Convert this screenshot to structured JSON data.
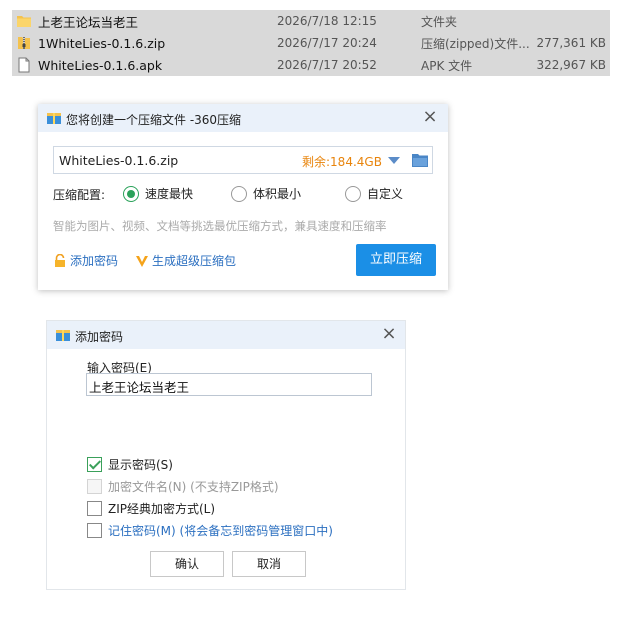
{
  "file_list": {
    "rows": [
      {
        "name": "上老王论坛当老王",
        "date": "2026/7/18 12:15",
        "type": "文件夹",
        "size": "",
        "icon": "folder-icon",
        "selected": true
      },
      {
        "name": "1WhiteLies-0.1.6.zip",
        "date": "2026/7/17 20:24",
        "type": "压缩(zipped)文件...",
        "size": "277,361 KB",
        "icon": "zip-file-icon",
        "selected": true
      },
      {
        "name": "WhiteLies-0.1.6.apk",
        "date": "2026/7/17 20:52",
        "type": "APK 文件",
        "size": "322,967 KB",
        "icon": "apk-file-icon",
        "selected": true
      }
    ]
  },
  "compress_dialog": {
    "title": "您将创建一个压缩文件 -360压缩",
    "close": "×",
    "filename": "WhiteLies-0.1.6.zip",
    "free_space": "剩余:184.4GB",
    "config_label": "压缩配置:",
    "options": [
      {
        "label": "速度最快",
        "selected": true
      },
      {
        "label": "体积最小",
        "selected": false
      },
      {
        "label": "自定义",
        "selected": false
      }
    ],
    "hint": "智能为图片、视频、文档等挑选最优压缩方式，兼具速度和压缩率",
    "add_password": "添加密码",
    "super_zip": "生成超级压缩包",
    "compress_button": "立即压缩",
    "accent": "#1b8fe6"
  },
  "password_dialog": {
    "title": "添加密码",
    "close": "×",
    "input_label": "输入密码(E)",
    "password_value": "上老王论坛当老王",
    "checkboxes": [
      {
        "label": "显示密码(S)",
        "checked": true,
        "disabled": false
      },
      {
        "label": "加密文件名(N) (不支持ZIP格式)",
        "checked": false,
        "disabled": true
      },
      {
        "label": "ZIP经典加密方式(L)",
        "checked": false,
        "disabled": false
      },
      {
        "label": "记住密码(M) (将会备忘到密码管理窗口中)",
        "checked": false,
        "disabled": false
      }
    ],
    "ok_button": "确认",
    "cancel_button": "取消"
  }
}
